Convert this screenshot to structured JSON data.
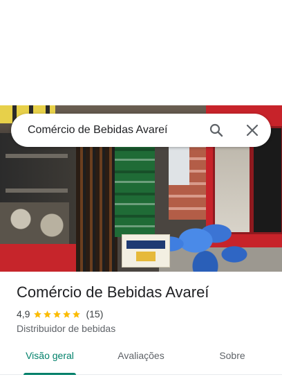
{
  "search": {
    "query": "Comércio de Bebidas Avareí",
    "icons": {
      "search": "search-icon",
      "close": "close-icon"
    }
  },
  "photo": {
    "description_icon": "store-photo"
  },
  "place": {
    "name": "Comércio de Bebidas Avareí",
    "rating": "4,9",
    "stars": 5,
    "reviews_count": "(15)",
    "category": "Distribuidor de bebidas"
  },
  "tabs": [
    {
      "label": "Visão geral",
      "active": true
    },
    {
      "label": "Avaliações",
      "active": false
    },
    {
      "label": "Sobre",
      "active": false
    }
  ],
  "colors": {
    "accent": "#00806a",
    "star": "#fbbc04",
    "text_primary": "#202124",
    "text_secondary": "#5f6368"
  }
}
